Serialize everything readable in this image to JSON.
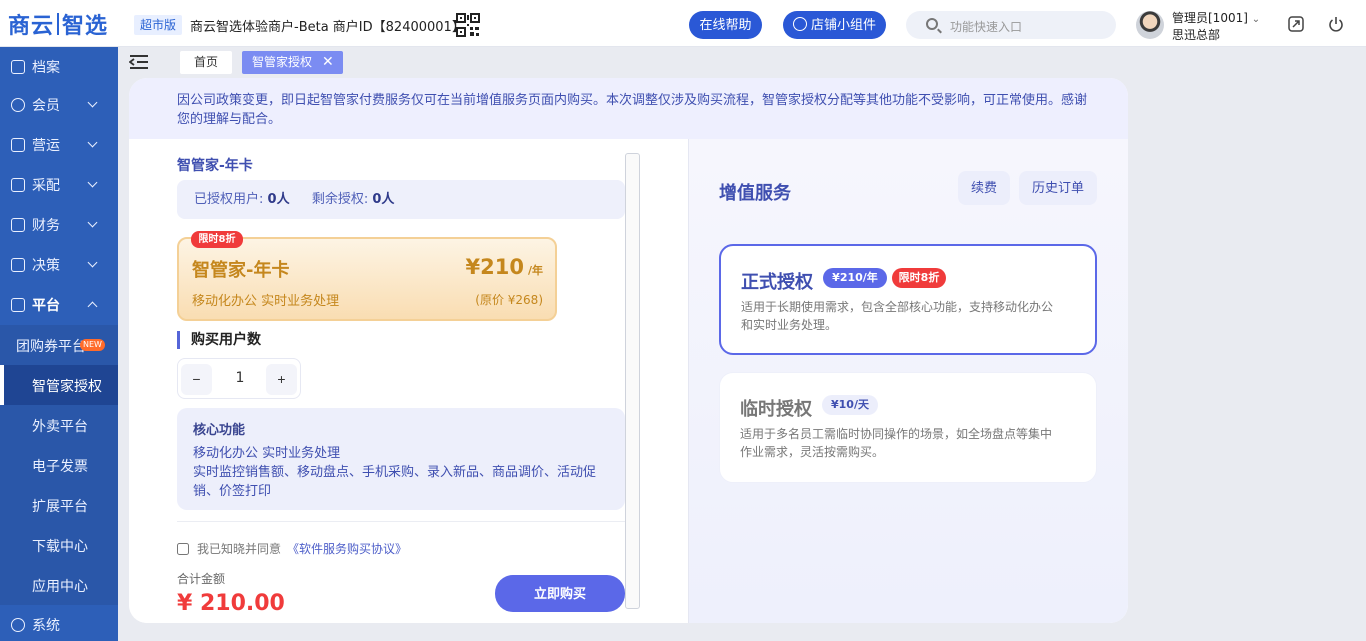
{
  "header": {
    "logo_left": "商云",
    "logo_right": "智选",
    "edition": "超市版",
    "merchant": "商云智选体验商户-Beta   商户ID【82400001】",
    "help_button": "在线帮助",
    "widget_button": "店铺小组件",
    "search_placeholder": "功能快速入口",
    "user_name": "管理员[1001]",
    "user_org": "思迅总部"
  },
  "sidebar": {
    "items": [
      {
        "label": "档案"
      },
      {
        "label": "会员"
      },
      {
        "label": "营运"
      },
      {
        "label": "采配"
      },
      {
        "label": "财务"
      },
      {
        "label": "决策"
      },
      {
        "label": "平台"
      }
    ],
    "sub_items": [
      {
        "label": "团购券平台",
        "badge": "NEW"
      },
      {
        "label": "智管家授权"
      },
      {
        "label": "外卖平台"
      },
      {
        "label": "电子发票"
      },
      {
        "label": "扩展平台"
      },
      {
        "label": "下载中心"
      },
      {
        "label": "应用中心"
      }
    ],
    "bottom_item": "系统"
  },
  "tabs": {
    "home": "首页",
    "active": "智管家授权",
    "close": "✕"
  },
  "notice": "因公司政策变更，即日起智管家付费服务仅可在当前增值服务页面内购买。本次调整仅涉及购买流程，智管家授权分配等其他功能不受影响，可正常使用。感谢您的理解与配合。",
  "left": {
    "title": "智管家-年卡",
    "authorized_label": "已授权用户:",
    "authorized_value": "0人",
    "remaining_label": "剩余授权:",
    "remaining_value": "0人",
    "discount_tag": "限时8折",
    "product_name": "智管家-年卡",
    "price": "¥210",
    "price_unit": "/年",
    "product_desc": "移动化办公 实时业务处理",
    "original_price": "(原价 ¥268)",
    "buy_count_title": "购买用户数",
    "quantity": "1",
    "minus": "−",
    "plus": "+",
    "features_title": "核心功能",
    "features_line1": "移动化办公 实时业务处理",
    "features_line2": "实时监控销售额、移动盘点、手机采购、录入新品、商品调价、活动促销、价签打印",
    "agree_text": "我已知晓并同意",
    "agreement_link": "《软件服务购买协议》",
    "total_label": "合计金额",
    "total_amount": "¥ 210.00",
    "buy_button": "立即购买"
  },
  "right": {
    "title": "增值服务",
    "renew_button": "续费",
    "history_button": "历史订单",
    "plans": [
      {
        "name": "正式授权",
        "price_tag": "¥210/年",
        "discount_tag": "限时8折",
        "desc": "适用于长期使用需求，包含全部核心功能，支持移动化办公和实时业务处理。"
      },
      {
        "name": "临时授权",
        "price_tag": "¥10/天",
        "desc": "适用于多名员工需临时协同操作的场景，如全场盘点等集中作业需求，灵活按需购买。"
      }
    ]
  },
  "colors": {
    "sidebar": "#2d5fb8",
    "primary": "#5b68e8",
    "accent_red": "#f03b3b",
    "gold": "#c5871d"
  }
}
